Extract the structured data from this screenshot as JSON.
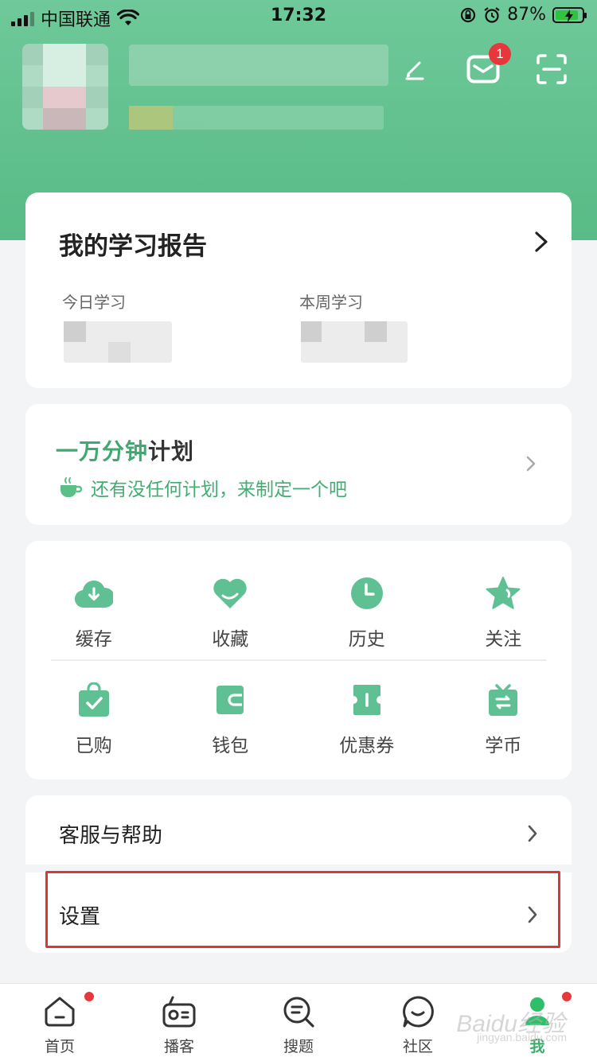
{
  "status_bar": {
    "carrier": "中国联通",
    "time": "17:32",
    "battery": "87%"
  },
  "header": {
    "message_badge": "1"
  },
  "report": {
    "title": "我的学习报告",
    "today_label": "今日学习",
    "week_label": "本周学习"
  },
  "plan": {
    "title_green": "一万分钟",
    "title_rest": "计划",
    "subtitle": "还有没任何计划，来制定一个吧"
  },
  "grid": {
    "row1": [
      {
        "label": "缓存",
        "icon": "cloud-download-icon"
      },
      {
        "label": "收藏",
        "icon": "heart-icon"
      },
      {
        "label": "历史",
        "icon": "clock-icon"
      },
      {
        "label": "关注",
        "icon": "star-icon"
      }
    ],
    "row2": [
      {
        "label": "已购",
        "icon": "shopping-bag-check-icon"
      },
      {
        "label": "钱包",
        "icon": "wallet-icon"
      },
      {
        "label": "优惠券",
        "icon": "coupon-icon"
      },
      {
        "label": "学币",
        "icon": "coin-box-icon"
      }
    ]
  },
  "menu": {
    "help": "客服与帮助",
    "settings": "设置"
  },
  "tabbar": [
    {
      "label": "首页",
      "icon": "home-icon"
    },
    {
      "label": "播客",
      "icon": "radio-icon"
    },
    {
      "label": "搜题",
      "icon": "search-question-icon"
    },
    {
      "label": "社区",
      "icon": "chat-smile-icon"
    },
    {
      "label": "我",
      "icon": "profile-icon"
    }
  ],
  "watermark": {
    "brand": "Baidu经验",
    "url": "jingyan.baidu.com"
  },
  "colors": {
    "brand_green": "#5fbf8c",
    "accent_red": "#e8373b",
    "highlight_red": "#d9373a"
  }
}
